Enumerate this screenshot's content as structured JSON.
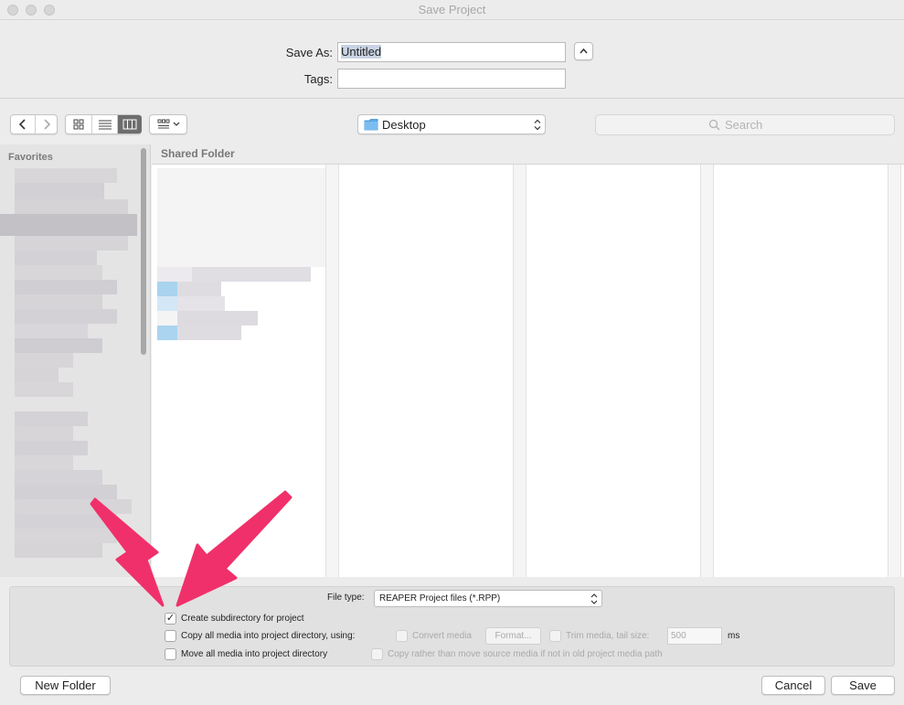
{
  "window": {
    "title": "Save Project"
  },
  "save_as": {
    "label": "Save As:",
    "value": "Untitled"
  },
  "tags": {
    "label": "Tags:",
    "value": ""
  },
  "location": {
    "value": "Desktop"
  },
  "search": {
    "placeholder": "Search"
  },
  "sidebar": {
    "section_label": "Favorites"
  },
  "browser": {
    "path_label": "Shared Folder"
  },
  "options": {
    "file_type_label": "File type:",
    "file_type_value": "REAPER Project files (*.RPP)",
    "create_subdirectory": {
      "label": "Create subdirectory for project",
      "checked": true
    },
    "copy_media": {
      "label": "Copy all media into project directory, using:",
      "checked": false
    },
    "convert_media": {
      "label": "Convert media",
      "checked": false,
      "enabled": false
    },
    "format_button": "Format...",
    "trim_media": {
      "label": "Trim media, tail size:",
      "checked": false,
      "enabled": false
    },
    "tail_size": {
      "value": "500",
      "unit": "ms"
    },
    "move_media": {
      "label": "Move all media into project directory",
      "checked": false
    },
    "copy_rather": {
      "label": "Copy rather than move source media if not in old project media path",
      "checked": false,
      "enabled": false
    }
  },
  "buttons": {
    "new_folder": "New Folder",
    "cancel": "Cancel",
    "save": "Save"
  },
  "colors": {
    "annotation_arrow": "#f0306a",
    "folder_blue": "#5aa9e6",
    "selection": "#c9d3e3"
  }
}
